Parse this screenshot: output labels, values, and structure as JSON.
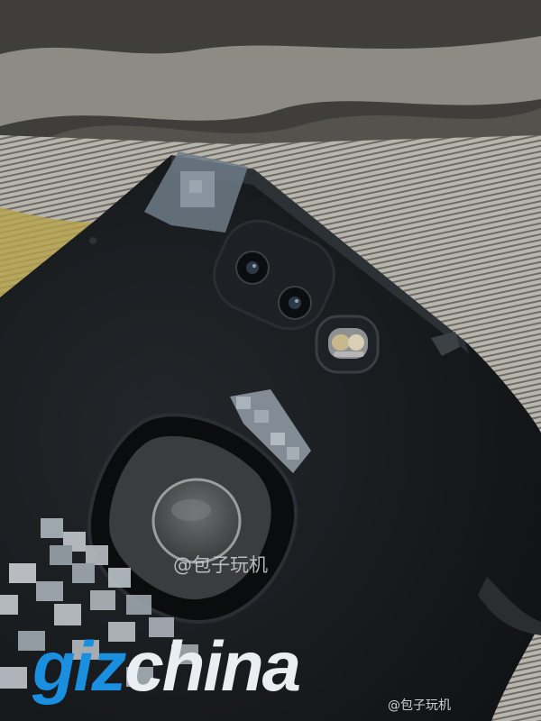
{
  "watermark_center": "@包子玩机",
  "watermark_bottom": "@包子玩机",
  "logo": {
    "part1": "giz",
    "part2": "china"
  },
  "colors": {
    "logo_blue": "#1a8fe0",
    "logo_white": "#e9eef2",
    "phone": "#121416",
    "cloth": "#9a978f"
  }
}
